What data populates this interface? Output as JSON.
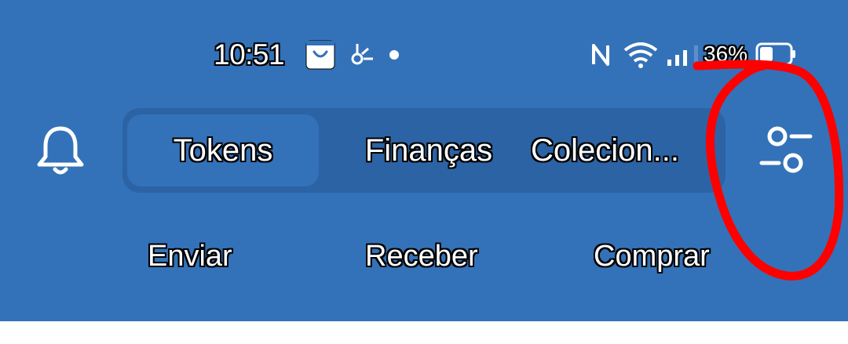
{
  "status_bar": {
    "time": "10:51",
    "battery_percent": "36%",
    "icons": [
      "shopping-bag-icon",
      "activity-icon",
      "notification-dot-icon",
      "nfc-icon",
      "wifi-icon",
      "signal-icon",
      "battery-icon"
    ]
  },
  "header": {
    "tabs": [
      {
        "label": "Tokens",
        "active": true
      },
      {
        "label": "Finanças",
        "active": false
      },
      {
        "label": "Colecion...",
        "active": false
      }
    ]
  },
  "actions": {
    "send": "Enviar",
    "receive": "Receber",
    "buy": "Comprar"
  },
  "colors": {
    "header_bg": "#3372b8",
    "tab_bar_bg": "#2c63a4",
    "annotation": "#ff0000"
  }
}
